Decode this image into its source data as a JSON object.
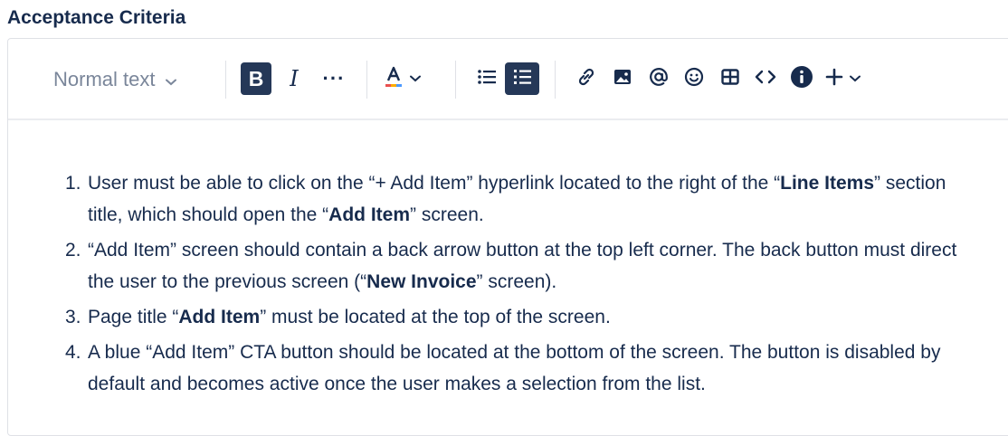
{
  "field": {
    "label": "Acceptance Criteria"
  },
  "toolbar": {
    "text_style": "Normal text",
    "text_style_icon": "chevron-down-icon",
    "bold_label": "B",
    "italic_label": "I",
    "more_label": "···",
    "text_color_icon": "text-color-icon",
    "bullet_list_icon": "bullet-list-icon",
    "numbered_list_icon": "numbered-list-icon",
    "link_icon": "link-icon",
    "image_icon": "image-icon",
    "mention_icon": "mention-icon",
    "emoji_icon": "emoji-icon",
    "table_icon": "table-icon",
    "code_icon": "code-icon",
    "info_icon": "info-panel-icon",
    "insert_icon": "plus-icon",
    "active_color": "#253858"
  },
  "criteria": [
    {
      "num": "1.",
      "parts": [
        {
          "t": "User must be able to click on the “+ Add Item” hyperlink located to the right of the “",
          "b": false
        },
        {
          "t": "Line Items",
          "b": true
        },
        {
          "t": "” section title, which should open the “",
          "b": false
        },
        {
          "t": "Add Item",
          "b": true
        },
        {
          "t": "” screen.",
          "b": false
        }
      ]
    },
    {
      "num": "2.",
      "parts": [
        {
          "t": "“Add Item” screen should contain a back arrow button at the top left corner. The back button must direct the user to the previous screen (“",
          "b": false
        },
        {
          "t": "New Invoice",
          "b": true
        },
        {
          "t": "” screen).",
          "b": false
        }
      ]
    },
    {
      "num": "3.",
      "parts": [
        {
          "t": "Page title “",
          "b": false
        },
        {
          "t": "Add Item",
          "b": true
        },
        {
          "t": "” must be located at the top of the screen.",
          "b": false
        }
      ]
    },
    {
      "num": "4.",
      "parts": [
        {
          "t": "A blue “Add Item” CTA button should be located at the bottom of the screen. The button is disabled by default and becomes active once the user makes a selection from the list.",
          "b": false
        }
      ]
    }
  ]
}
